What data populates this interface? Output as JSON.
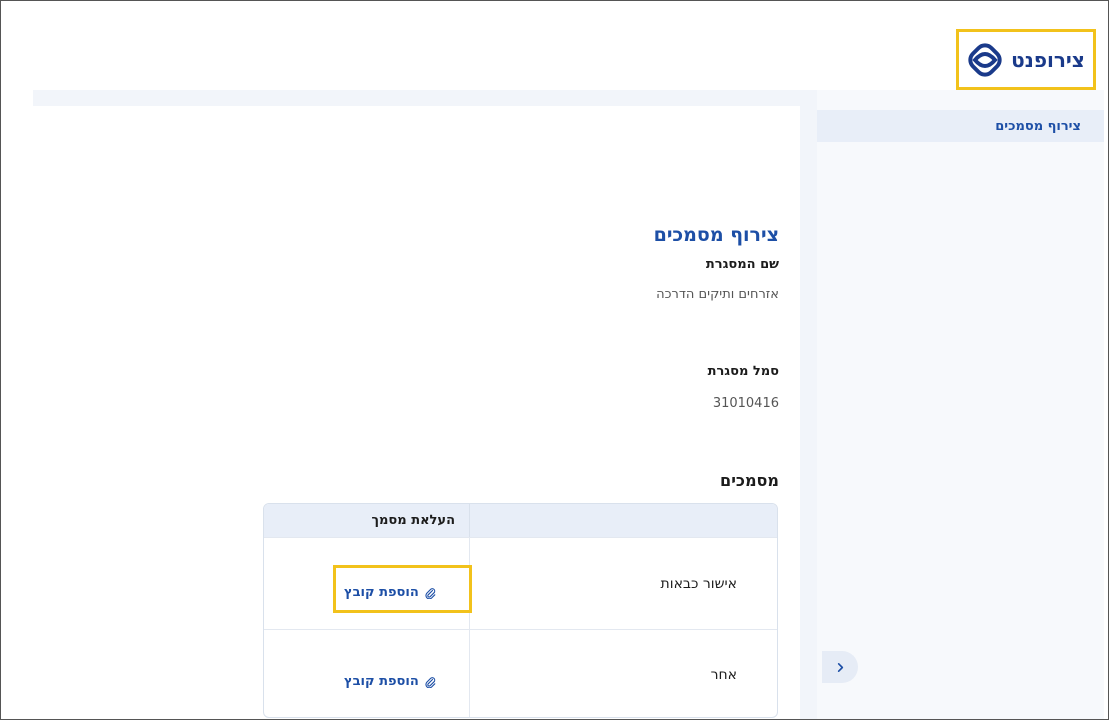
{
  "brand": {
    "name": "צירופנט"
  },
  "sidebar": {
    "items": [
      {
        "label": "צירוף מסמכים"
      }
    ]
  },
  "main": {
    "title": "צירוף מסמכים",
    "fields": [
      {
        "label": "שם המסגרת",
        "value": "אזרחים ותיקים הדרכה"
      },
      {
        "label": "סמל מסגרת",
        "value": "31010416"
      }
    ],
    "section_title": "מסמכים",
    "table": {
      "upload_header": "העלאת מסמך",
      "rows": [
        {
          "name": "אישור כבאות",
          "action": "הוספת קובץ"
        },
        {
          "name": "אחר",
          "action": "הוספת קובץ"
        }
      ]
    }
  },
  "colors": {
    "accent": "#1d4fa6",
    "highlight": "#f2c21b"
  },
  "icons": {
    "logo": "interlocking-loop-icon",
    "collapse": "chevron-right-icon",
    "attach": "paperclip-icon"
  }
}
